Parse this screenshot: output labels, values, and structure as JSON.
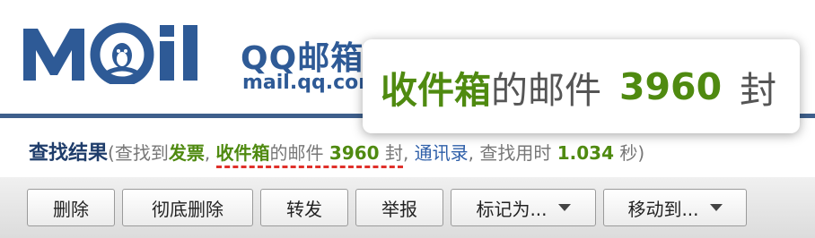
{
  "header": {
    "brand_title": "QQ邮箱",
    "brand_domain": "mail.qq.com",
    "logo_text": "Mail"
  },
  "zoom": {
    "folder": "收件箱",
    "text1": "的邮件",
    "count": "3960",
    "unit": "封"
  },
  "result": {
    "title": "查找结果",
    "prefix": "(查找到",
    "invoice": "发票",
    "comma1": ",",
    "folder": "收件箱",
    "text1": "的邮件",
    "count": "3960",
    "unit": "封",
    "comma2": ",",
    "contacts": "通讯录",
    "comma3": ",",
    "time_prefix": "查找用时",
    "time_value": "1.034",
    "time_unit": "秒)"
  },
  "toolbar": {
    "delete": "删除",
    "delete_forever": "彻底删除",
    "forward": "转发",
    "report": "举报",
    "mark_as": "标记为...",
    "move_to": "移动到..."
  },
  "colors": {
    "brand_blue": "#2e5a96",
    "accent_green": "#4f8a10",
    "highlight_red": "#e0302a"
  }
}
